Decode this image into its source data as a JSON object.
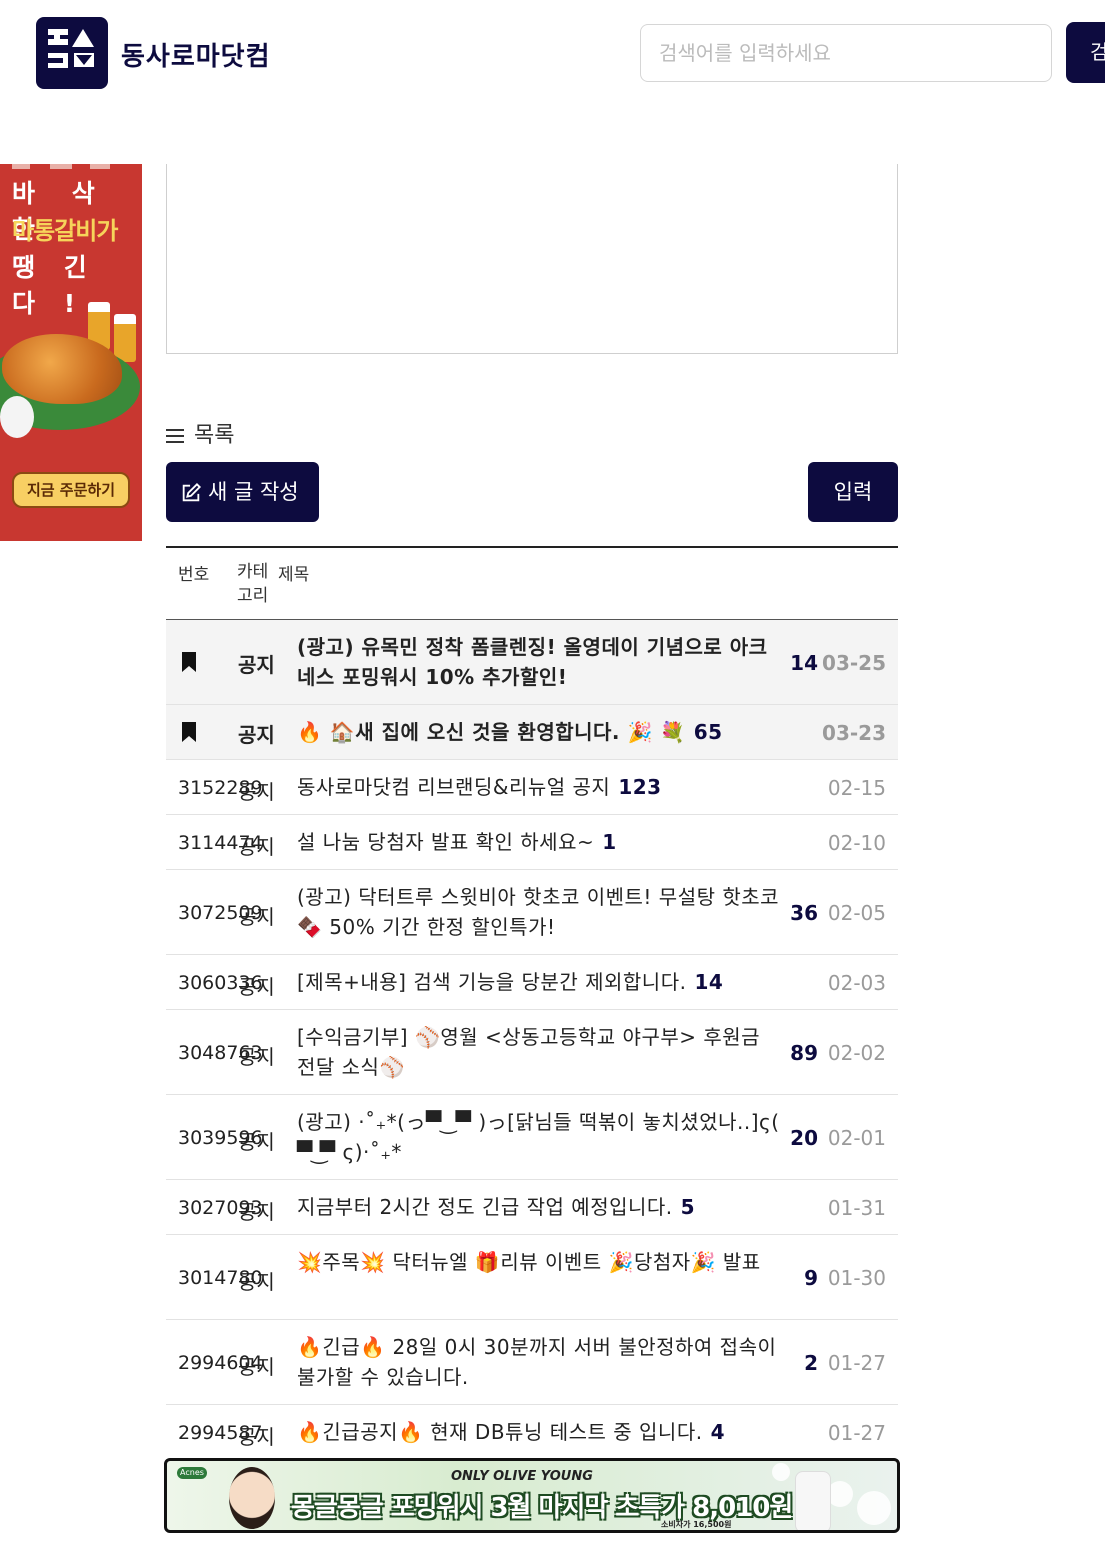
{
  "header": {
    "logo_label": "logo",
    "site_name": "동사로마닷컴",
    "search_placeholder": "검색어를 입력하세요",
    "search_button": "검"
  },
  "side_ad": {
    "line1": "바 삭 한",
    "line2": "마통갈비가",
    "line3": "땡 긴 다 !",
    "cta": "지금 주문하기"
  },
  "list": {
    "heading": "목록",
    "new_post_label": "새 글 작성",
    "submit_label": "입력",
    "columns": {
      "num": "번호",
      "category": "카테고리",
      "title": "제목"
    }
  },
  "rows": [
    {
      "num": "",
      "category": "공지",
      "title": "(광고) 유목민 정착 폼클렌징! 올영데이 기념으로 아크네스 포밍워시 10% 추가할인!",
      "comments": "14",
      "date": "03-25",
      "notice": true
    },
    {
      "num": "",
      "category": "공지",
      "title": "🔥 🏠새 집에 오신 것을 환영합니다. 🎉 💐",
      "comments": "65",
      "date": "03-23",
      "notice": true
    },
    {
      "num": "3152289",
      "category": "공지",
      "title": "동사로마닷컴 리브랜딩&리뉴얼 공지",
      "comments": "123",
      "date": "02-15"
    },
    {
      "num": "3114474",
      "category": "공지",
      "title": "설 나눔 당첨자 발표 확인 하세요~",
      "comments": "1",
      "date": "02-10"
    },
    {
      "num": "3072509",
      "category": "공지",
      "title": "(광고) 닥터트루 스윗비아 핫초코 이벤트! 무설탕 핫초코🍫 50% 기간 한정 할인특가!",
      "comments": "36",
      "date": "02-05"
    },
    {
      "num": "3060336",
      "category": "공지",
      "title": "[제목+내용] 검색 기능을 당분간 제외합니다.",
      "comments": "14",
      "date": "02-03"
    },
    {
      "num": "3048763",
      "category": "공지",
      "title": "[수익금기부] ⚾영월 <상동고등학교 야구부> 후원금 전달 소식⚾",
      "comments": "89",
      "date": "02-02"
    },
    {
      "num": "3039596",
      "category": "공지",
      "title": "(광고) ·˚₊*(っ▀ ͜ ▀ )っ[닭님들 떡볶이 놓치셨었나..]ς( ▀ ͜▀ ς)·˚₊*",
      "comments": "20",
      "date": "02-01"
    },
    {
      "num": "3027093",
      "category": "공지",
      "title": "지금부터 2시간 정도 긴급 작업 예정입니다.",
      "comments": "5",
      "date": "01-31"
    },
    {
      "num": "3014780",
      "category": "공지",
      "title": "💥주목💥 닥터뉴엘 🎁리뷰 이벤트 🎉당첨자🎉 발표",
      "comments": "9",
      "date": "01-30"
    },
    {
      "num": "2994604",
      "category": "공지",
      "title": "🔥긴급🔥 28일 0시 30분까지 서버 불안정하여 접속이 불가할 수 있습니다.",
      "comments": "2",
      "date": "01-27"
    },
    {
      "num": "2994587",
      "category": "공지",
      "title": "🔥긴급공지🔥 현재 DB튜닝 테스트 중 입니다.",
      "comments": "4",
      "date": "01-27"
    }
  ],
  "bottom_ad": {
    "brand": "Acnes",
    "sponsor": "ONLY OLIVE YOUNG",
    "headline": "몽글몽글 포밍워시 3월 마지막 초특가 8,010원",
    "fine_print": "소비자가 16,500원"
  }
}
